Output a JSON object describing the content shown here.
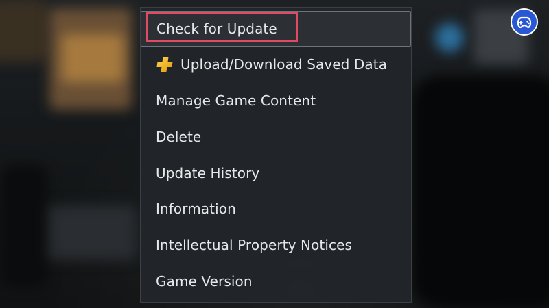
{
  "menu": {
    "items": [
      {
        "label": "Check for Update",
        "selected": true,
        "icon": null
      },
      {
        "label": "Upload/Download Saved Data",
        "selected": false,
        "icon": "ps-plus-icon"
      },
      {
        "label": "Manage Game Content",
        "selected": false,
        "icon": null
      },
      {
        "label": "Delete",
        "selected": false,
        "icon": null
      },
      {
        "label": "Update History",
        "selected": false,
        "icon": null
      },
      {
        "label": "Information",
        "selected": false,
        "icon": null
      },
      {
        "label": "Intellectual Property Notices",
        "selected": false,
        "icon": null
      },
      {
        "label": "Game Version",
        "selected": false,
        "icon": null
      }
    ]
  },
  "colors": {
    "highlight": "#e04b63",
    "plus_gold": "#f2b325",
    "logo_blue": "#2a58d4"
  },
  "logo": {
    "icon": "gamepad-logo-icon"
  }
}
